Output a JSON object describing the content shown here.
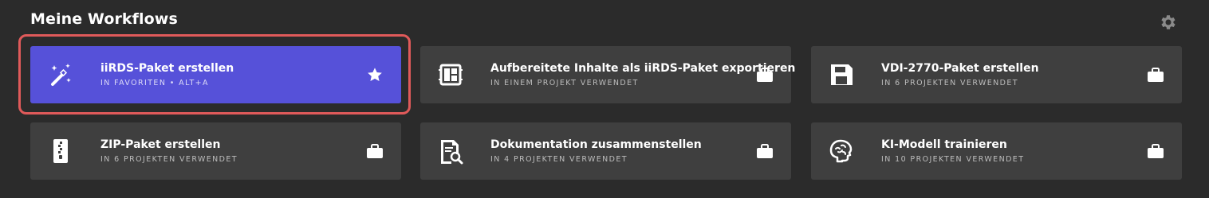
{
  "header": {
    "title": "Meine Workflows",
    "settings_icon": "gear-icon"
  },
  "colors": {
    "background": "#2b2b2b",
    "card": "#3f3f3f",
    "card_active": "#5651d9",
    "highlight": "#e05a5a"
  },
  "workflows": [
    {
      "title": "iiRDS-Paket erstellen",
      "subtitle": "IN FAVORITEN • ALT+A",
      "icon": "magic-wand-icon",
      "action_icon": "star-icon",
      "active": true
    },
    {
      "title": "Aufbereitete Inhalte als iiRDS-Paket exportieren",
      "subtitle": "IN EINEM PROJEKT VERWENDET",
      "icon": "layout-panel-icon",
      "action_icon": "briefcase-icon",
      "active": false
    },
    {
      "title": "VDI-2770-Paket erstellen",
      "subtitle": "IN 6 PROJEKTEN VERWENDET",
      "icon": "floppy-disk-icon",
      "action_icon": "briefcase-icon",
      "active": false
    },
    {
      "title": "ZIP-Paket erstellen",
      "subtitle": "IN 6 PROJEKTEN VERWENDET",
      "icon": "zip-file-icon",
      "action_icon": "briefcase-icon",
      "active": false
    },
    {
      "title": "Dokumentation zusammenstellen",
      "subtitle": "IN 4 PROJEKTEN VERWENDET",
      "icon": "document-search-icon",
      "action_icon": "briefcase-icon",
      "active": false
    },
    {
      "title": "KI-Modell trainieren",
      "subtitle": "IN 10 PROJEKTEN VERWENDET",
      "icon": "brain-icon",
      "action_icon": "briefcase-icon",
      "active": false
    }
  ]
}
